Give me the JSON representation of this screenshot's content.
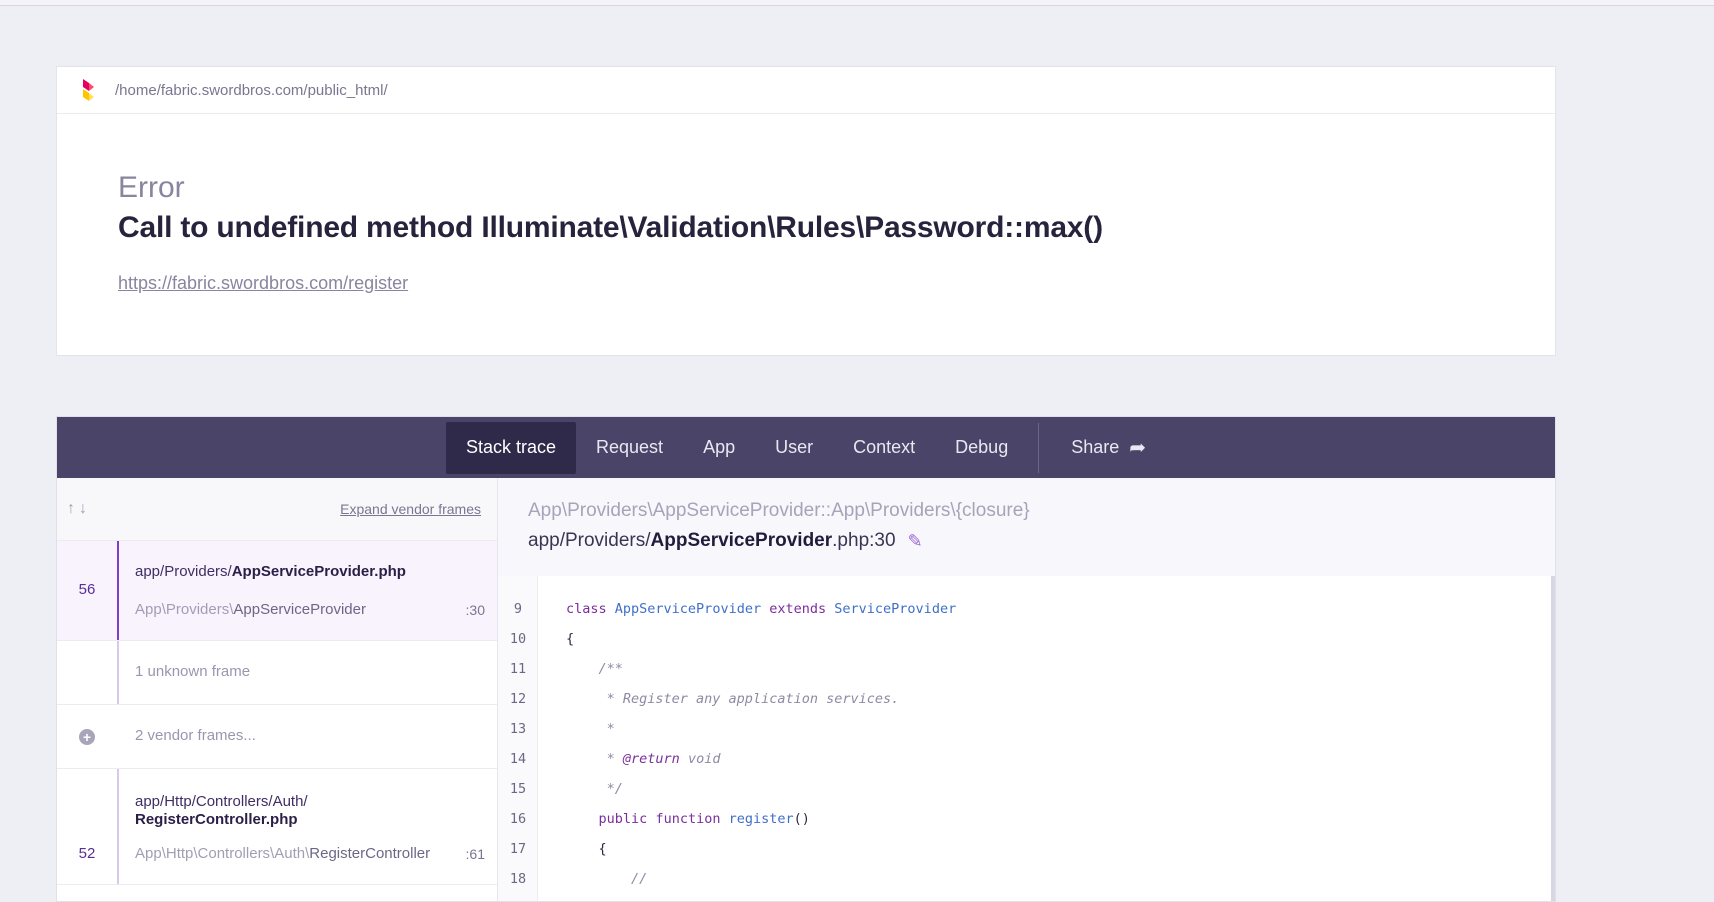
{
  "header": {
    "path": "/home/fabric.swordbros.com/public_html/",
    "error_type": "Error",
    "error_message": "Call to undefined method Illuminate\\Validation\\Rules\\Password::max()",
    "url": "https://fabric.swordbros.com/register"
  },
  "tabs": [
    {
      "label": "Stack trace",
      "active": true
    },
    {
      "label": "Request"
    },
    {
      "label": "App"
    },
    {
      "label": "User"
    },
    {
      "label": "Context"
    },
    {
      "label": "Debug"
    }
  ],
  "share_label": "Share",
  "frames_panel": {
    "expand_label": "Expand vendor frames",
    "frames": [
      {
        "number": "56",
        "file_prefix": "app/Providers/",
        "file_name": "AppServiceProvider.php",
        "class_prefix": "App\\Providers\\",
        "class_name": "AppServiceProvider",
        "line": ":30"
      },
      {
        "muted": "1 unknown frame"
      },
      {
        "muted": "2 vendor frames..."
      },
      {
        "number": "52",
        "file_prefix": "app/Http/Controllers/Auth/",
        "file_name": "RegisterController.php",
        "class_prefix": "App\\Http\\Controllers\\Auth\\",
        "class_name": "RegisterController",
        "line": ":61"
      }
    ]
  },
  "code": {
    "function": "App\\Providers\\AppServiceProvider::App\\Providers\\{closure}",
    "file_prefix": "app/Providers/",
    "file_name": "AppServiceProvider",
    "file_suffix": ".php:30",
    "line_numbers": [
      "9",
      "10",
      "11",
      "12",
      "13",
      "14",
      "15",
      "16",
      "17",
      "18"
    ],
    "lines": {
      "l9_kw1": "class",
      "l9_t1": "AppServiceProvider",
      "l9_kw2": "extends",
      "l9_t2": "ServiceProvider",
      "l10": "{",
      "l11": "    /**",
      "l12": "     * Register any application services.",
      "l13": "     *",
      "l14_a": "     * ",
      "l14_tag": "@return",
      "l14_b": " void",
      "l15": "     */",
      "l16_kw1": "public",
      "l16_kw2": "function",
      "l16_fn": "register",
      "l16_end": "()",
      "l17": "    {",
      "l18": "        //"
    }
  },
  "colors": {
    "nav_bg": "#4a4568",
    "accent": "#7d3fc4",
    "page_bg": "#eeeef5"
  }
}
